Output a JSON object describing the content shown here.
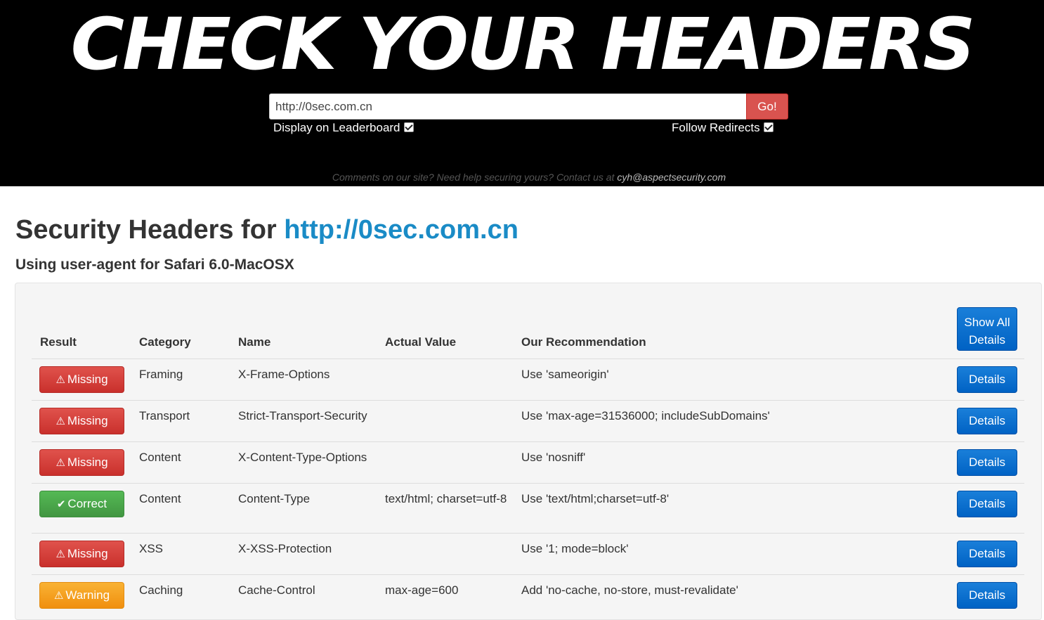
{
  "header": {
    "logo_text": "CHECK YOUR HEADERS",
    "url_value": "http://0sec.com.cn",
    "go_label": "Go!",
    "leaderboard_label": "Display on Leaderboard",
    "leaderboard_checked": true,
    "redirects_label": "Follow Redirects",
    "redirects_checked": true,
    "contact_text": "Comments on our site? Need help securing yours? Contact us at",
    "contact_email": "cyh@aspectsecurity.com"
  },
  "main": {
    "title_prefix": "Security Headers for",
    "title_url": "http://0sec.com.cn",
    "subtitle": "Using user-agent for Safari 6.0-MacOSX"
  },
  "table": {
    "columns": [
      "Result",
      "Category",
      "Name",
      "Actual Value",
      "Our Recommendation"
    ],
    "show_all_label": "Show All Details",
    "details_label": "Details",
    "rows": [
      {
        "result": "Missing",
        "status": "missing",
        "category": "Framing",
        "name": "X-Frame-Options",
        "actual": "",
        "recommendation": "Use 'sameorigin'"
      },
      {
        "result": "Missing",
        "status": "missing",
        "category": "Transport",
        "name": "Strict-Transport-Security",
        "actual": "",
        "recommendation": "Use 'max-age=31536000; includeSubDomains'"
      },
      {
        "result": "Missing",
        "status": "missing",
        "category": "Content",
        "name": "X-Content-Type-Options",
        "actual": "",
        "recommendation": "Use 'nosniff'"
      },
      {
        "result": "Correct",
        "status": "correct",
        "category": "Content",
        "name": "Content-Type",
        "actual": "text/html; charset=utf-8",
        "recommendation": "Use 'text/html;charset=utf-8'"
      },
      {
        "result": "Missing",
        "status": "missing",
        "category": "XSS",
        "name": "X-XSS-Protection",
        "actual": "",
        "recommendation": "Use '1; mode=block'"
      },
      {
        "result": "Warning",
        "status": "warning",
        "category": "Caching",
        "name": "Cache-Control",
        "actual": "max-age=600",
        "recommendation": "Add 'no-cache, no-store, must-revalidate'"
      }
    ]
  },
  "icons": {
    "missing": "warning-triangle-icon",
    "correct": "checkmark-icon",
    "warning": "warning-triangle-icon"
  },
  "colors": {
    "missing": "#d9534f",
    "correct": "#4cae4c",
    "warning": "#f0ad4e",
    "primary": "#0069d9",
    "link": "#1a8bc6"
  }
}
